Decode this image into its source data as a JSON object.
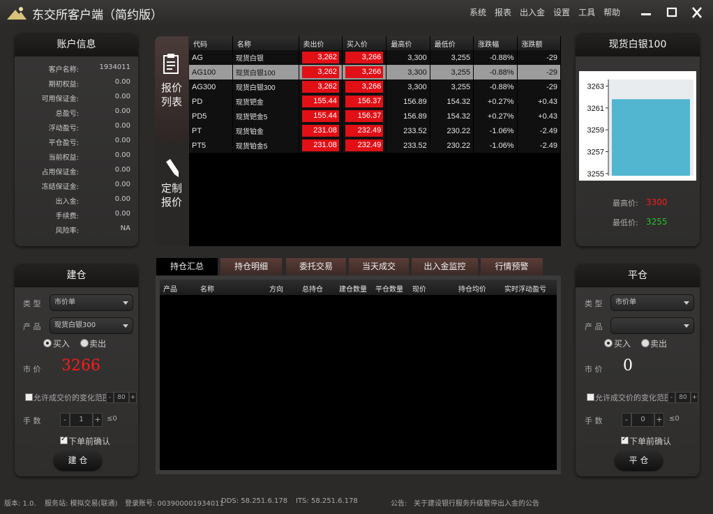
{
  "window": {
    "title": "东交所客户端（简约版）"
  },
  "menu": [
    "系统",
    "报表",
    "出入金",
    "设置",
    "工具",
    "帮助"
  ],
  "account": {
    "title": "账户信息",
    "rows": [
      {
        "k": "客户名称:",
        "v": "1934011"
      },
      {
        "k": "期初权益:",
        "v": "0.00"
      },
      {
        "k": "可用保证金:",
        "v": "0.00"
      },
      {
        "k": "总盈亏:",
        "v": "0.00"
      },
      {
        "k": "浮动盈亏:",
        "v": "0.00"
      },
      {
        "k": "平仓盈亏:",
        "v": "0.00"
      },
      {
        "k": "当前权益:",
        "v": "0.00"
      },
      {
        "k": "占用保证金:",
        "v": "0.00"
      },
      {
        "k": "冻结保证金:",
        "v": "0.00"
      },
      {
        "k": "出入金:",
        "v": "0.00"
      },
      {
        "k": "手续费:",
        "v": "0.00"
      },
      {
        "k": "风险率:",
        "v": "NA"
      }
    ]
  },
  "side_tabs": {
    "quote_list_1": "报价",
    "quote_list_2": "列表",
    "custom_1": "定制",
    "custom_2": "报价"
  },
  "quote_table": {
    "headers": [
      "代码",
      "名称",
      "卖出价",
      "买入价",
      "最高价",
      "最低价",
      "涨跌幅",
      "涨跌额"
    ],
    "rows": [
      {
        "code": "AG",
        "name": "现货白银",
        "sell": "3,262",
        "buy": "3,266",
        "high": "3,300",
        "low": "3,255",
        "pct": "-0.88%",
        "chg": "-29",
        "dir": "dn",
        "selected": false
      },
      {
        "code": "AG100",
        "name": "现货白银100",
        "sell": "3,262",
        "buy": "3,266",
        "high": "3,300",
        "low": "3,255",
        "pct": "-0.88%",
        "chg": "-29",
        "dir": "dn",
        "selected": true
      },
      {
        "code": "AG300",
        "name": "现货白银300",
        "sell": "3,262",
        "buy": "3,266",
        "high": "3,300",
        "low": "3,255",
        "pct": "-0.88%",
        "chg": "-29",
        "dir": "dn",
        "selected": false
      },
      {
        "code": "PD",
        "name": "现货钯金",
        "sell": "155.44",
        "buy": "156.37",
        "high": "156.89",
        "low": "154.32",
        "pct": "+0.27%",
        "chg": "+0.43",
        "dir": "up",
        "selected": false
      },
      {
        "code": "PD5",
        "name": "现货钯金5",
        "sell": "155.44",
        "buy": "156.37",
        "high": "156.89",
        "low": "154.32",
        "pct": "+0.27%",
        "chg": "+0.43",
        "dir": "up",
        "selected": false
      },
      {
        "code": "PT",
        "name": "现货铂金",
        "sell": "231.08",
        "buy": "232.49",
        "high": "233.52",
        "low": "230.22",
        "pct": "-1.06%",
        "chg": "-2.49",
        "dir": "dn",
        "selected": false
      },
      {
        "code": "PT5",
        "name": "现货铂金5",
        "sell": "231.08",
        "buy": "232.49",
        "high": "233.52",
        "low": "230.22",
        "pct": "-1.06%",
        "chg": "-2.49",
        "dir": "dn",
        "selected": false
      }
    ]
  },
  "bottom_tabs": [
    "持仓汇总",
    "持仓明细",
    "委托交易",
    "当天成交",
    "出入金监控",
    "行情预警"
  ],
  "position_headers": [
    "产品",
    "名称",
    "方向",
    "总持仓",
    "建仓数量",
    "平仓数量",
    "现价",
    "持仓均价",
    "实时浮动盈亏"
  ],
  "product_card": {
    "title": "现货白银100",
    "high_label": "最高价:",
    "high": "3300",
    "low_label": "最低价:",
    "low": "3255",
    "chart_data": {
      "type": "bar",
      "categories": [
        ""
      ],
      "values": [
        3261.8
      ],
      "ylim": [
        3254.8,
        3263.6
      ],
      "yticks": [
        "3263",
        "3261",
        "3259",
        "3257",
        "3255"
      ],
      "ytick_values": [
        3263,
        3261,
        3259,
        3257,
        3255
      ],
      "bar_color": "#52b6d0"
    }
  },
  "open_panel": {
    "title": "建仓",
    "type_label": "类 型",
    "type_value": "市价单",
    "product_label": "产 品",
    "product_value": "现货白银300",
    "buy": "买入",
    "sell": "卖出",
    "price_label": "市 价",
    "price": "3266",
    "allow_label": "允许成交价的变化范围",
    "range_value": "80",
    "qty_label": "手 数",
    "qty": "1",
    "qty_limit": "≤0",
    "confirm_label": "下单前确认",
    "submit": "建 仓"
  },
  "close_panel": {
    "title": "平仓",
    "type_label": "类 型",
    "type_value": "市价单",
    "product_label": "产 品",
    "product_value": "",
    "buy": "买入",
    "sell": "卖出",
    "price_label": "市 价",
    "price": "0",
    "allow_label": "允许成交价的变化范围",
    "range_value": "80",
    "qty_label": "手 数",
    "qty": "0",
    "qty_limit": "≤0",
    "confirm_label": "下单前确认",
    "submit": "平 仓"
  },
  "status": {
    "version": "版本: 1.0.",
    "server": "服务站: 模拟交易(联通)",
    "account": "登录账号: 003900001934011",
    "dds": "DDS: 58.251.6.178",
    "its": "ITS: 58.251.6.178",
    "notice_label": "公告:",
    "notice": "关于建设银行服务升级暂停出入金的公告"
  },
  "colors": {
    "up": "#ff3b3b",
    "down": "#27c227",
    "price_red": "#ff1a1a",
    "sell_cell": "#e01016"
  }
}
